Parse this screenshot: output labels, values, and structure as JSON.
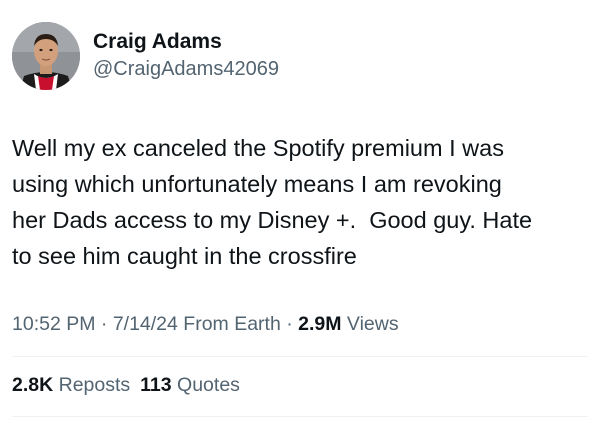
{
  "author": {
    "name": "Craig Adams",
    "handle": "@CraigAdams42069"
  },
  "tweet": {
    "lines": [
      "Well my ex canceled the Spotify premium I was",
      "using which unfortunately means I am revoking",
      "her Dads access to my Disney +.  Good guy. Hate",
      "to see him caught in the crossfire"
    ]
  },
  "meta": {
    "time": "10:52 PM",
    "sep1": " · ",
    "date": "7/14/24",
    "source": " From Earth",
    "sep2": " · ",
    "views_count": "2.9M",
    "views_label": " Views"
  },
  "stats": {
    "reposts_count": "2.8K",
    "reposts_label": " Reposts",
    "quotes_count": "113",
    "quotes_label": " Quotes"
  },
  "colors": {
    "text": "#0f1419",
    "secondary": "#536471",
    "divider": "#eff3f4",
    "background": "#ffffff"
  }
}
